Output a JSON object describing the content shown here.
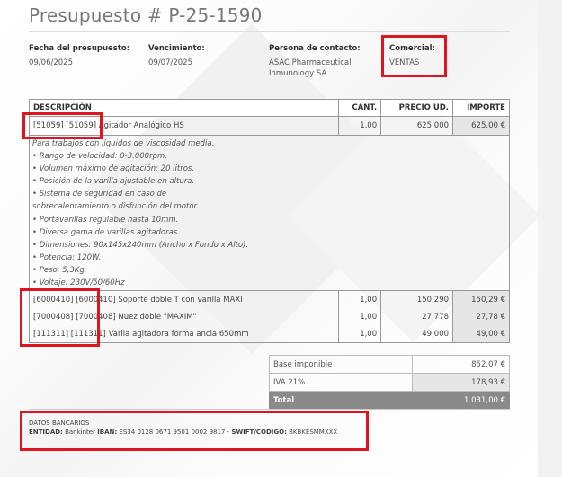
{
  "document": {
    "title": "Presupuesto # P-25-1590"
  },
  "meta": {
    "fecha_label": "Fecha del presupuesto:",
    "fecha_value": "09/06/2025",
    "vencimiento_label": "Vencimiento:",
    "vencimiento_value": "09/07/2025",
    "contacto_label": "Persona de contacto:",
    "contacto_value_1": "ASAC Pharmaceutical",
    "contacto_value_2": "Inmunology SA",
    "comercial_label": "Comercial:",
    "comercial_value": "VENTAS"
  },
  "table": {
    "headers": [
      "DESCRIPCIÓN",
      "CANT.",
      "PRECIO UD.",
      "IMPORTE"
    ],
    "rows": [
      {
        "code": "[51059] [51059]",
        "name": " Agitador Analógico HS",
        "qty": "1,00",
        "price": "625,000",
        "amount": "625,00 €"
      },
      {
        "code": "[6000410] [6000410]",
        "name": " Soporte doble T con varilla MAXI",
        "qty": "1,00",
        "price": "150,290",
        "amount": "150,29 €"
      },
      {
        "code": "[7000408] [7000408]",
        "name": " Nuez doble \"MAXIM\"",
        "qty": "1,00",
        "price": "27,778",
        "amount": "27,78 €"
      },
      {
        "code": "[111311] [111311]",
        "name": " Varila agitadora forma ancla 650mm",
        "qty": "1,00",
        "price": "49,000",
        "amount": "49,00 €"
      }
    ],
    "description_lines": [
      "Para trabajos con líquidos de viscosidad media.",
      "• Rango de velocidad: 0-3.000rpm.",
      "• Volumen máximo de agitación: 20 litros.",
      "• Posición de la varilla ajustable en altura.",
      "• Sistema de seguridad en caso de",
      "sobrecalentamiento o disfunción del motor.",
      "• Portavarillas regulable hasta 10mm.",
      "• Diversa gama de varillas agitadoras.",
      "• Dimensiones: 90x145x240mm (Ancho x Fondo x Alto).",
      "• Potencia: 120W.",
      "• Peso: 5,3Kg.",
      "• Voltaje: 230V/50/60Hz"
    ]
  },
  "totals": {
    "base_label": "Base imponible",
    "base_value": "852,07 €",
    "iva_label": "IVA 21%",
    "iva_value": "178,93 €",
    "total_label": "Total",
    "total_value": "1.031,00 €"
  },
  "bank": {
    "title": "DATOS BANCARIOS",
    "entidad_label": "ENTIDAD:",
    "entidad_value": " Bankinter ",
    "iban_label": "IBAN:",
    "iban_value": " ES34 0128 0671 9501 0002 9817 - ",
    "swift_label": "SWIFT/CÓDIGO:",
    "swift_value": " BKBKESMMXXX"
  },
  "colors": {
    "highlight_box": "#e0141e",
    "total_bar": "#8a8a8a",
    "amount_cell": "#e6e6e6"
  }
}
